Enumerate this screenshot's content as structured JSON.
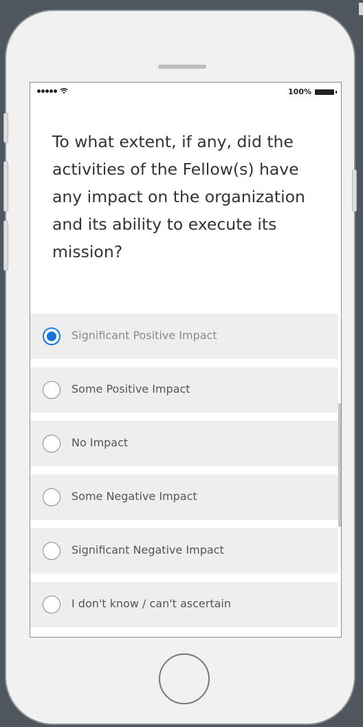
{
  "status_bar": {
    "battery_text": "100%"
  },
  "question": "To what extent, if any, did the activities of the Fellow(s) have any impact on the organization and its ability to execute its mission?",
  "options": [
    {
      "label": "Significant Positive Impact",
      "selected": true
    },
    {
      "label": "Some Positive Impact",
      "selected": false
    },
    {
      "label": "No Impact",
      "selected": false
    },
    {
      "label": "Some Negative Impact",
      "selected": false
    },
    {
      "label": "Significant Negative Impact",
      "selected": false
    },
    {
      "label": "I don't know / can't ascertain",
      "selected": false
    }
  ],
  "colors": {
    "accent": "#1a73d6",
    "frame": "#4f565e"
  }
}
